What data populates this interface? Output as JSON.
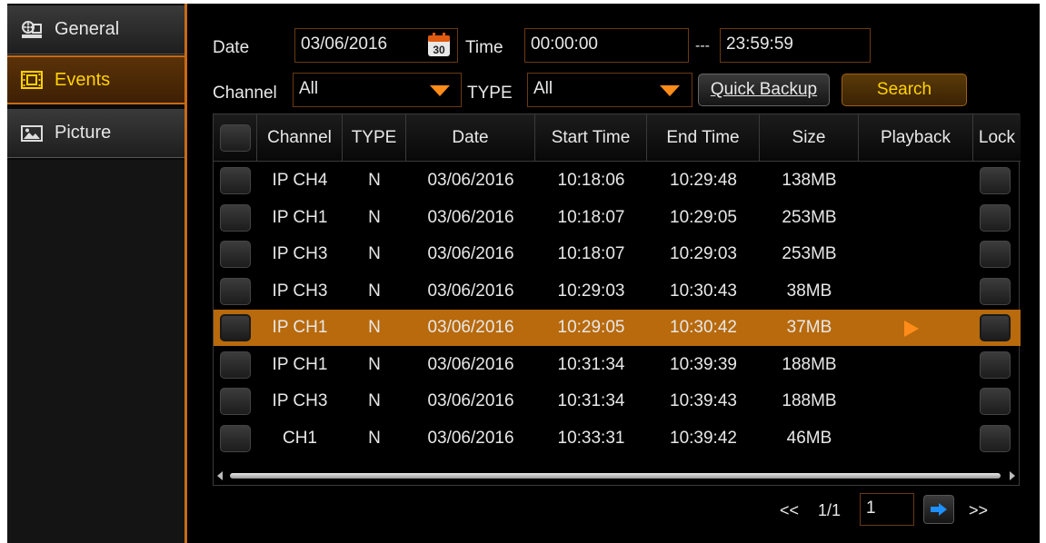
{
  "sidebar": {
    "items": [
      {
        "label": "General",
        "icon": "film-reel-icon"
      },
      {
        "label": "Events",
        "icon": "film-strip-icon"
      },
      {
        "label": "Picture",
        "icon": "picture-icon"
      }
    ]
  },
  "filters": {
    "date_label": "Date",
    "date_value": "03/06/2016",
    "calendar_day": "30",
    "time_label": "Time",
    "time_start": "00:00:00",
    "time_separator": "---",
    "time_end": "23:59:59",
    "channel_label": "Channel",
    "channel_value": "All",
    "type_label": "TYPE",
    "type_value": "All",
    "quick_backup_label": "Quick Backup",
    "search_label": "Search"
  },
  "table": {
    "columns": [
      "Channel",
      "TYPE",
      "Date",
      "Start Time",
      "End Time",
      "Size",
      "Playback",
      "Lock"
    ],
    "rows": [
      {
        "channel": "IP CH4",
        "type": "N",
        "date": "03/06/2016",
        "start": "10:18:06",
        "end": "10:29:48",
        "size": "138MB"
      },
      {
        "channel": "IP CH1",
        "type": "N",
        "date": "03/06/2016",
        "start": "10:18:07",
        "end": "10:29:05",
        "size": "253MB"
      },
      {
        "channel": "IP CH3",
        "type": "N",
        "date": "03/06/2016",
        "start": "10:18:07",
        "end": "10:29:03",
        "size": "253MB"
      },
      {
        "channel": "IP CH3",
        "type": "N",
        "date": "03/06/2016",
        "start": "10:29:03",
        "end": "10:30:43",
        "size": "38MB"
      },
      {
        "channel": "IP CH1",
        "type": "N",
        "date": "03/06/2016",
        "start": "10:29:05",
        "end": "10:30:42",
        "size": "37MB"
      },
      {
        "channel": "IP CH1",
        "type": "N",
        "date": "03/06/2016",
        "start": "10:31:34",
        "end": "10:39:39",
        "size": "188MB"
      },
      {
        "channel": "IP CH3",
        "type": "N",
        "date": "03/06/2016",
        "start": "10:31:34",
        "end": "10:39:43",
        "size": "188MB"
      },
      {
        "channel": "CH1",
        "type": "N",
        "date": "03/06/2016",
        "start": "10:33:31",
        "end": "10:39:42",
        "size": "46MB"
      }
    ],
    "selected_row": 5
  },
  "pager": {
    "first": "<<",
    "page_info": "1/1",
    "page_input": "1",
    "last": ">>"
  },
  "colors": {
    "accent": "#c86a14",
    "highlight_row": "#b86a0c",
    "active_text": "#ffd200",
    "playback_arrow": "#ff8c1a",
    "go_arrow": "#1e90ff"
  }
}
